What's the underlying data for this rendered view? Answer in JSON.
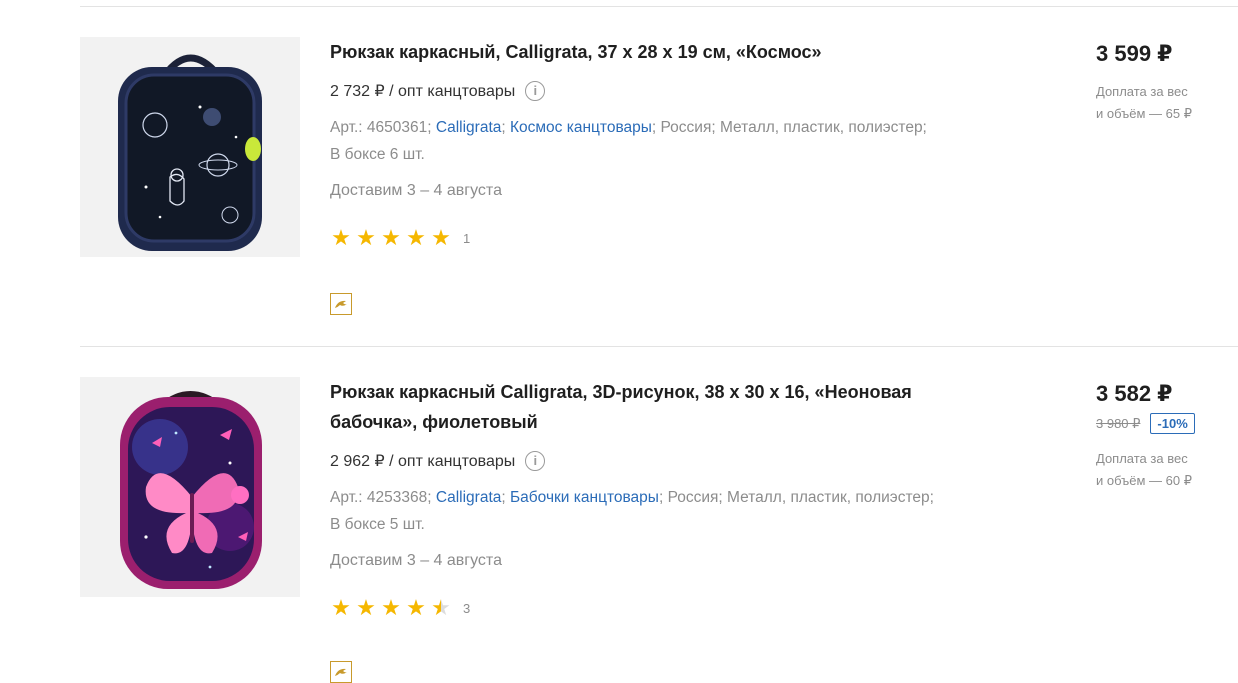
{
  "products": [
    {
      "title": "Рюкзак каркасный, Calligrata, 37 х 28 х 19 см, «Космос»",
      "wholesale": "2 732 ₽ / опт канцтовары",
      "info_icon": "info-icon",
      "article": "Арт.: 4650361;",
      "brand_link": "Calligrata",
      "sep1": ";",
      "collection_link": "Космос канцтовары",
      "attributes": "; Россия; Металл, пластик, полиэстер;",
      "box": "В боксе 6 шт.",
      "delivery": "Доставим 3 – 4 августа",
      "rating": 5,
      "reviews": "1",
      "price": "3 599 ₽",
      "surcharge_line1": "Доплата за вес",
      "surcharge_line2": "и объём — 65 ₽",
      "image": "backpack-space-image"
    },
    {
      "title": "Рюкзак каркасный Calligrata, 3D-рисунок, 38 х 30 х 16, «Неоновая бабочка», фиолетовый",
      "wholesale": "2 962 ₽ / опт канцтовары",
      "info_icon": "info-icon",
      "article": "Арт.: 4253368;",
      "brand_link": "Calligrata",
      "sep1": ";",
      "collection_link": "Бабочки канцтовары",
      "attributes": "; Россия; Металл, пластик, полиэстер;",
      "box": "В боксе 5 шт.",
      "delivery": "Доставим 3 – 4 августа",
      "rating": 4.5,
      "reviews": "3",
      "price": "3 582 ₽",
      "old_price": "3 980 ₽",
      "discount": "-10%",
      "surcharge_line1": "Доплата за вес",
      "surcharge_line2": "и объём — 60 ₽",
      "image": "backpack-butterfly-image"
    }
  ],
  "colors": {
    "link": "#2b6cb8",
    "star": "#f5b700",
    "muted": "#8c8c8c"
  }
}
